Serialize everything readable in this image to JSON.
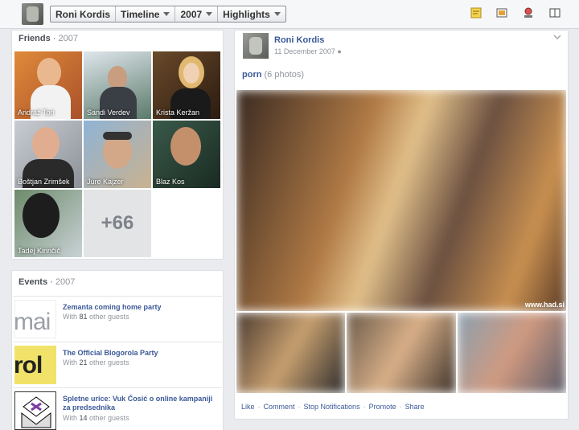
{
  "breadcrumb": [
    "Roni Kordis",
    "Timeline",
    "2007",
    "Highlights"
  ],
  "friends": {
    "title": "Friends",
    "year": "2007",
    "items": [
      "Andraž Tori",
      "Sandi Verdev",
      "Krista Keržan",
      "Boštjan Zrimšek",
      "Jure Kajzer",
      "Blaz Kos",
      "Tadej Kirinčič"
    ],
    "more": "+66"
  },
  "events": {
    "title": "Events",
    "year": "2007",
    "items": [
      {
        "title": "Zemanta coming home party",
        "guests_prefix": "With ",
        "guests_count": "81",
        "guests_suffix": " other guests",
        "thumb": "mai"
      },
      {
        "title": "The Official Blogorola Party",
        "guests_prefix": "With ",
        "guests_count": "21",
        "guests_suffix": " other guests",
        "thumb": "rol"
      },
      {
        "title": "Spletne urice: Vuk Ćosić o online kampaniji za predsednika",
        "guests_prefix": "With ",
        "guests_count": "14",
        "guests_suffix": " other guests",
        "thumb": ""
      }
    ]
  },
  "post": {
    "author": "Roni Kordis",
    "date": "11 December 2007",
    "album_name": "porn",
    "album_count": "(6 photos)",
    "watermark": "www.had.si",
    "actions": [
      "Like",
      "Comment",
      "Stop Notifications",
      "Promote",
      "Share"
    ]
  },
  "colors": {
    "link": "#3b5998",
    "topbar": "#f6f7f9",
    "background": "#e9ebee"
  },
  "icons": [
    "notes-icon",
    "photos-icon",
    "map-pin-icon",
    "book-icon",
    "globe-icon",
    "chevron-down-icon"
  ]
}
